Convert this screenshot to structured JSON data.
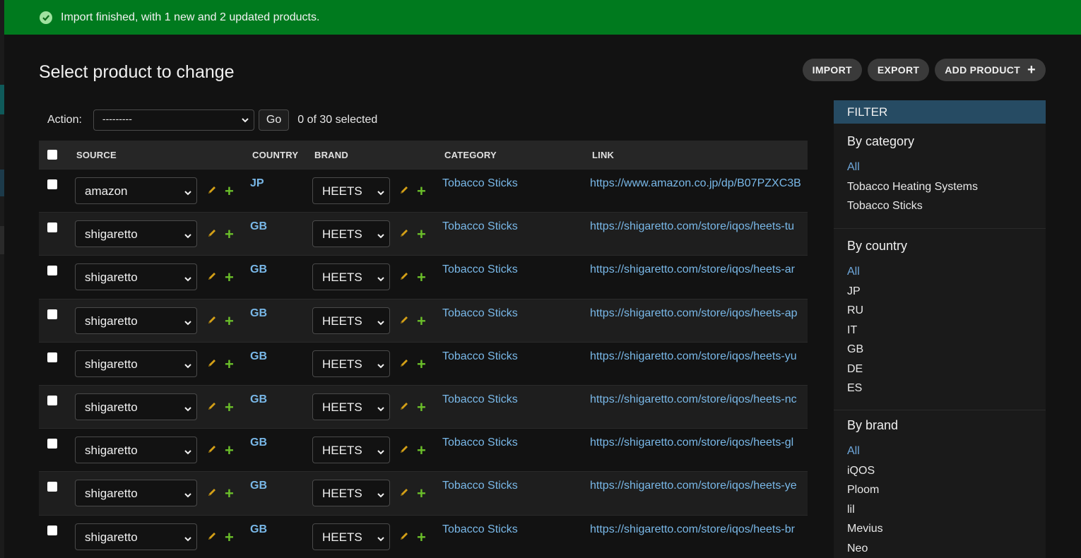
{
  "message": "Import finished, with 1 new and 2 updated products.",
  "page_title": "Select product to change",
  "object_tools": {
    "import": "IMPORT",
    "export": "EXPORT",
    "add": "ADD PRODUCT",
    "add_icon": "+"
  },
  "actions": {
    "label": "Action:",
    "selected": "---------",
    "go": "Go",
    "counter": "0 of 30 selected"
  },
  "columns": {
    "source": "SOURCE",
    "country": "COUNTRY",
    "brand": "BRAND",
    "category": "CATEGORY",
    "link": "LINK"
  },
  "rows": [
    {
      "source": "amazon",
      "country": "JP",
      "brand": "HEETS",
      "category": "Tobacco Sticks",
      "link": "https://www.amazon.co.jp/dp/B07PZXC3B"
    },
    {
      "source": "shigaretto",
      "country": "GB",
      "brand": "HEETS",
      "category": "Tobacco Sticks",
      "link": "https://shigaretto.com/store/iqos/heets-tu"
    },
    {
      "source": "shigaretto",
      "country": "GB",
      "brand": "HEETS",
      "category": "Tobacco Sticks",
      "link": "https://shigaretto.com/store/iqos/heets-ar"
    },
    {
      "source": "shigaretto",
      "country": "GB",
      "brand": "HEETS",
      "category": "Tobacco Sticks",
      "link": "https://shigaretto.com/store/iqos/heets-ap"
    },
    {
      "source": "shigaretto",
      "country": "GB",
      "brand": "HEETS",
      "category": "Tobacco Sticks",
      "link": "https://shigaretto.com/store/iqos/heets-yu"
    },
    {
      "source": "shigaretto",
      "country": "GB",
      "brand": "HEETS",
      "category": "Tobacco Sticks",
      "link": "https://shigaretto.com/store/iqos/heets-nc"
    },
    {
      "source": "shigaretto",
      "country": "GB",
      "brand": "HEETS",
      "category": "Tobacco Sticks",
      "link": "https://shigaretto.com/store/iqos/heets-gl"
    },
    {
      "source": "shigaretto",
      "country": "GB",
      "brand": "HEETS",
      "category": "Tobacco Sticks",
      "link": "https://shigaretto.com/store/iqos/heets-ye"
    },
    {
      "source": "shigaretto",
      "country": "GB",
      "brand": "HEETS",
      "category": "Tobacco Sticks",
      "link": "https://shigaretto.com/store/iqos/heets-br"
    }
  ],
  "filter": {
    "title": "FILTER",
    "by_category": {
      "title": "By category",
      "items": [
        "All",
        "Tobacco Heating Systems",
        "Tobacco Sticks"
      ]
    },
    "by_country": {
      "title": "By country",
      "items": [
        "All",
        "JP",
        "RU",
        "IT",
        "GB",
        "DE",
        "ES"
      ]
    },
    "by_brand": {
      "title": "By brand",
      "items": [
        "All",
        "iQOS",
        "Ploom",
        "lil",
        "Mevius",
        "Neo"
      ]
    }
  },
  "colors": {
    "success": "#007a1e",
    "link": "#79b8e8",
    "filter_header": "#264b63",
    "add_icon": "#6bbf2a",
    "edit_icon": "#d4a017"
  }
}
